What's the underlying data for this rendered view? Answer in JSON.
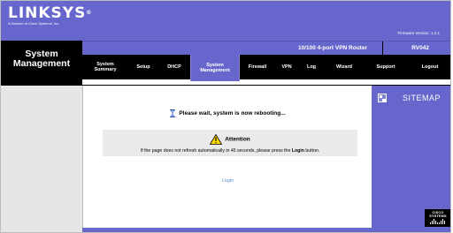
{
  "header": {
    "logo_text": "LINKSYS",
    "logo_sub": "A Division of Cisco Systems, Inc.",
    "firmware": "Firmware Version: 1.2.1"
  },
  "section": {
    "title_line1": "System",
    "title_line2": "Management"
  },
  "product": {
    "name": "10/100 4-port VPN Router",
    "model": "RV042"
  },
  "nav": {
    "items": [
      {
        "label_line1": "System",
        "label_line2": "Summary"
      },
      {
        "label_line1": "Setup",
        "label_line2": ""
      },
      {
        "label_line1": "DHCP",
        "label_line2": ""
      },
      {
        "label_line1": "System",
        "label_line2": "Management"
      },
      {
        "label_line1": "Firewall",
        "label_line2": ""
      },
      {
        "label_line1": "VPN",
        "label_line2": ""
      },
      {
        "label_line1": "Log",
        "label_line2": ""
      },
      {
        "label_line1": "Wizard",
        "label_line2": ""
      },
      {
        "label_line1": "Support",
        "label_line2": ""
      },
      {
        "label_line1": "Logout",
        "label_line2": ""
      }
    ],
    "active_index": 3
  },
  "sidebar": {
    "sitemap_label": "SITEMAP"
  },
  "main": {
    "wait_message": "Please wait, system is now rebooting...",
    "attention_title": "Attention",
    "attention_msg_pre": "If the page does not refresh automatically in 45 seconds, please press the ",
    "attention_msg_bold": "Login",
    "attention_msg_post": " button.",
    "login_link": "Login"
  },
  "footer": {
    "cisco_text": "CISCO SYSTEMS"
  },
  "colors": {
    "brand_purple": "#6666cc",
    "black": "#000000",
    "panel_gray": "#e6e6e6",
    "link_blue": "#5a8fd6"
  }
}
